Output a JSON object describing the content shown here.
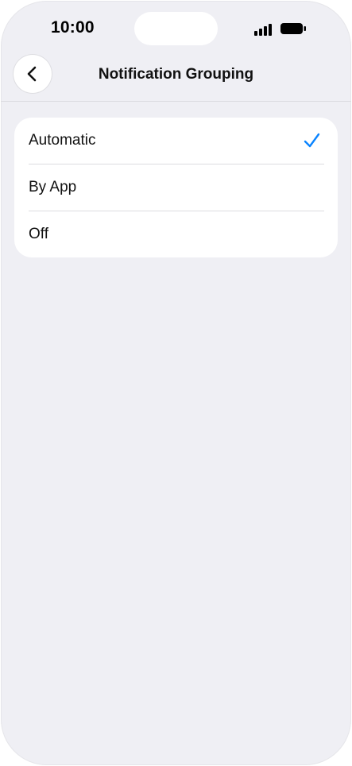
{
  "status_bar": {
    "time": "10:00",
    "icons": [
      "signal-icon",
      "battery-icon"
    ]
  },
  "nav": {
    "title": "Notification Grouping",
    "back_icon": "chevron-left-icon"
  },
  "options": [
    {
      "label": "Automatic",
      "selected": true
    },
    {
      "label": "By App",
      "selected": false
    },
    {
      "label": "Off",
      "selected": false
    }
  ],
  "colors": {
    "accent": "#0a84ff",
    "background": "#efeff4",
    "card": "#ffffff"
  }
}
